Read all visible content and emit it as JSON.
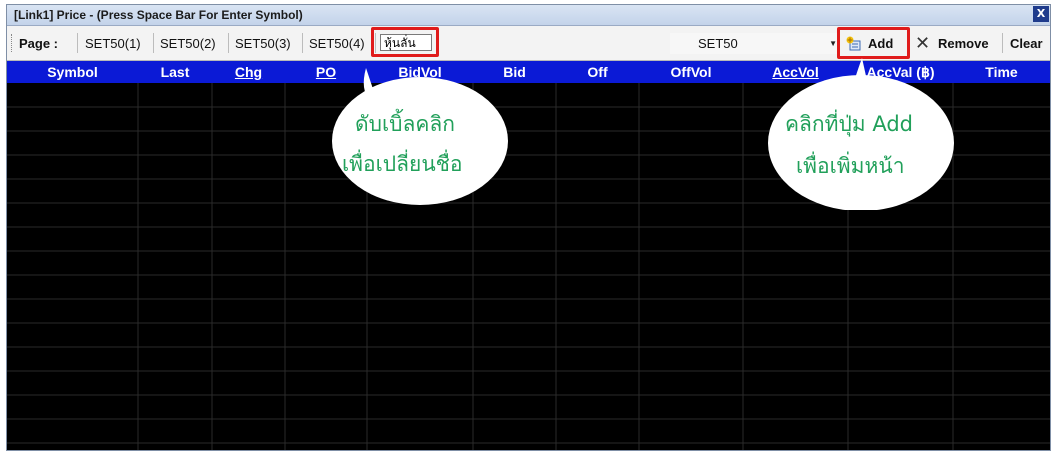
{
  "window": {
    "title": "[Link1] Price - (Press Space Bar For Enter Symbol)",
    "close_label": "X"
  },
  "toolbar": {
    "page_label": "Page :",
    "tabs": [
      "SET50(1)",
      "SET50(2)",
      "SET50(3)",
      "SET50(4)"
    ],
    "tab_edit_value": "หุ้นลั่น",
    "combo_value": "SET50",
    "add_label": "Add",
    "remove_label": "Remove",
    "clear_label": "Clear"
  },
  "columns": [
    {
      "label": "Symbol",
      "underline": false
    },
    {
      "label": "Last",
      "underline": false
    },
    {
      "label": "Chg",
      "underline": true
    },
    {
      "label": "PO",
      "underline": true
    },
    {
      "label": "BidVol",
      "underline": false
    },
    {
      "label": "Bid",
      "underline": false
    },
    {
      "label": "Off",
      "underline": false
    },
    {
      "label": "OffVol",
      "underline": false
    },
    {
      "label": "AccVol",
      "underline": true
    },
    {
      "label": "AccVal (฿)",
      "underline": false
    },
    {
      "label": "Time",
      "underline": false
    }
  ],
  "annotations": {
    "left_line1": "ดับเบิ้ลคลิก",
    "left_line2": "เพื่อเปลี่ยนชื่อ",
    "right_line1": "คลิกที่ปุ่ม Add",
    "right_line2": "เพื่อเพิ่มหน้า"
  },
  "colors": {
    "header_bg": "#0b1ad6",
    "grid_bg": "#000000",
    "grid_lines": "#2a2a2a",
    "highlight": "#e01b1b",
    "annotation_text": "#21a05a"
  }
}
